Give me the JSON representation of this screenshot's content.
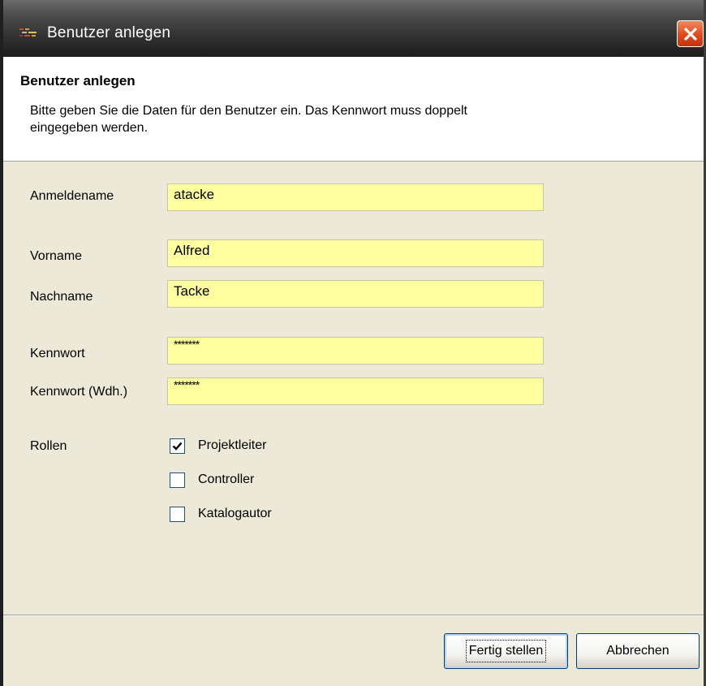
{
  "window": {
    "title": "Benutzer anlegen"
  },
  "header": {
    "title": "Benutzer anlegen",
    "description": "Bitte geben Sie die Daten für den Benutzer ein. Das Kennwort muss doppelt eingegeben werden."
  },
  "form": {
    "login_label": "Anmeldename",
    "login_value": "atacke",
    "firstname_label": "Vorname",
    "firstname_value": "Alfred",
    "lastname_label": "Nachname",
    "lastname_value": "Tacke",
    "password_label": "Kennwort",
    "password_value": "*******",
    "password_repeat_label": "Kennwort (Wdh.)",
    "password_repeat_value": "*******",
    "roles_label": "Rollen",
    "roles": [
      {
        "label": "Projektleiter",
        "checked": true
      },
      {
        "label": "Controller",
        "checked": false
      },
      {
        "label": "Katalogautor",
        "checked": false
      }
    ]
  },
  "buttons": {
    "finish_label": "Fertig stellen",
    "cancel_label": "Abbrechen"
  },
  "colors": {
    "field_background": "#ffffa0",
    "close_button": "#de4a1c"
  },
  "icons": {
    "app": "app-icon",
    "close": "close-icon",
    "check": "checkmark-icon"
  }
}
